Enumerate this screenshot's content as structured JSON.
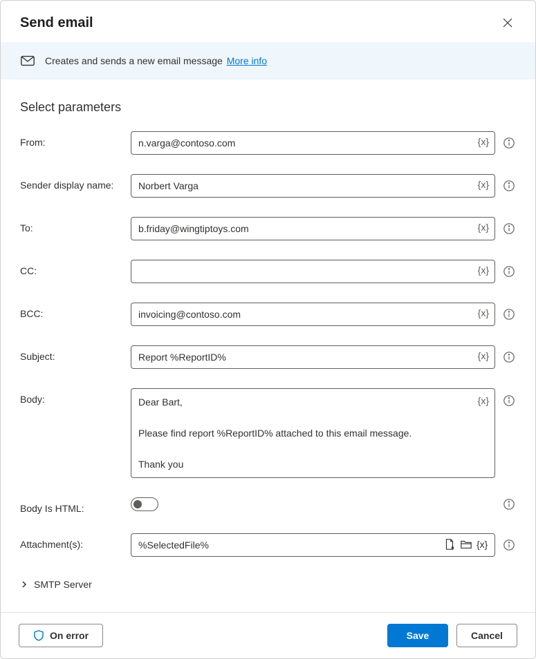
{
  "header": {
    "title": "Send email"
  },
  "description": {
    "text": "Creates and sends a new email message",
    "more_info": "More info"
  },
  "section_title": "Select parameters",
  "fields": {
    "from": {
      "label": "From:",
      "value": "n.varga@contoso.com"
    },
    "sender_name": {
      "label": "Sender display name:",
      "value": "Norbert Varga"
    },
    "to": {
      "label": "To:",
      "value": "b.friday@wingtiptoys.com"
    },
    "cc": {
      "label": "CC:",
      "value": ""
    },
    "bcc": {
      "label": "BCC:",
      "value": "invoicing@contoso.com"
    },
    "subject": {
      "label": "Subject:",
      "value": "Report %ReportID%"
    },
    "body": {
      "label": "Body:",
      "value": "Dear Bart,\n\nPlease find report %ReportID% attached to this email message.\n\nThank you"
    },
    "body_html": {
      "label": "Body Is HTML:",
      "value": false
    },
    "attachments": {
      "label": "Attachment(s):",
      "value": "%SelectedFile%"
    }
  },
  "variable_token": "{x}",
  "expander": {
    "smtp": "SMTP Server"
  },
  "footer": {
    "on_error": "On error",
    "save": "Save",
    "cancel": "Cancel"
  }
}
